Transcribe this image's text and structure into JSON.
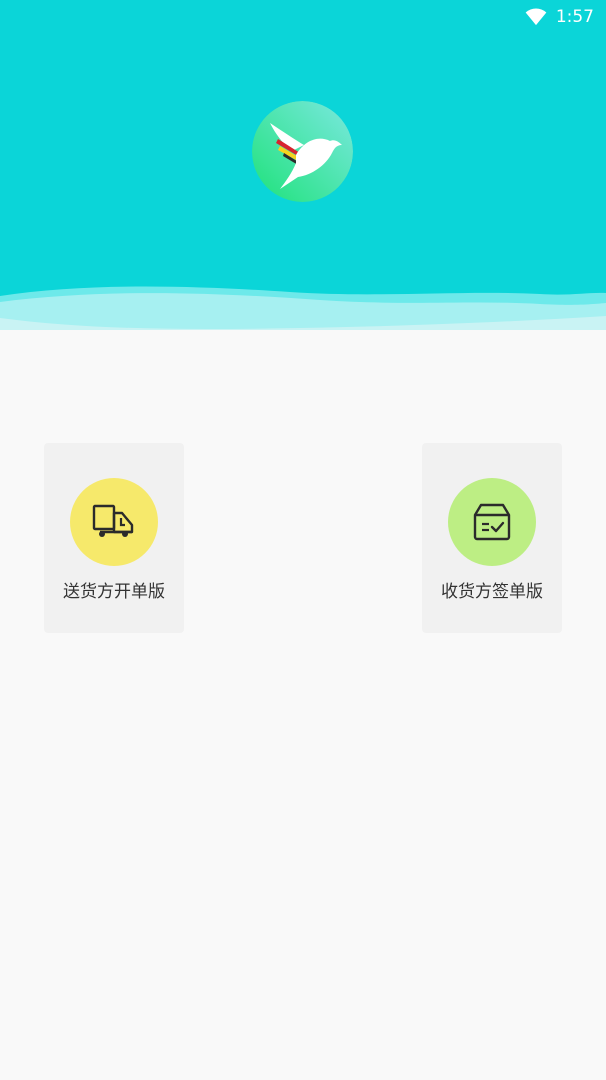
{
  "status_bar": {
    "time": "1:57",
    "icons": [
      "wifi-icon"
    ]
  },
  "header": {
    "background_color": "#0bd5d8",
    "logo_icon": "hummingbird-logo-icon"
  },
  "cards": [
    {
      "label": "送货方开单版",
      "icon": "delivery-truck-icon",
      "circle_color": "#f6e96b"
    },
    {
      "label": "收货方签单版",
      "icon": "package-sign-icon",
      "circle_color": "#bdee84"
    }
  ]
}
